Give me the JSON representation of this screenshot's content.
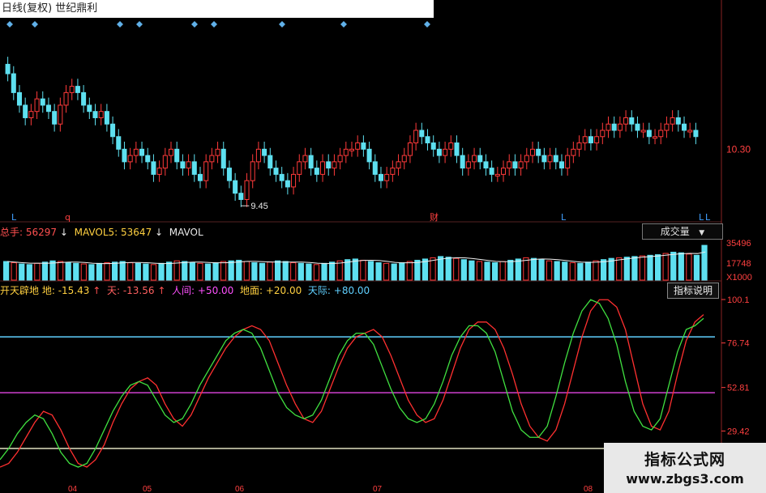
{
  "window": {
    "title": "日线(复权) 世纪鼎利"
  },
  "price_panel": {
    "right_axis_label": "10.30",
    "low_annotation": "9.45",
    "markers": [
      {
        "text": "L",
        "color": "#40a0ff"
      },
      {
        "text": "q",
        "color": "#ff4040"
      },
      {
        "text": "财",
        "color": "#ff4040"
      },
      {
        "text": "L",
        "color": "#40a0ff"
      },
      {
        "text": "L",
        "color": "#40a0ff"
      },
      {
        "text": "L",
        "color": "#40a0ff"
      }
    ]
  },
  "volume_panel": {
    "total_label": "总手:",
    "total_value": "56297",
    "mavol5_label": "MAVOL5:",
    "mavol5_value": "53647",
    "mavol_label": "MAVOL",
    "down_arrow": "↓",
    "dropdown_label": "成交量",
    "dropdown_caret": "▼",
    "axis_labels": [
      "35496",
      "17748",
      "X1000"
    ]
  },
  "indicator_panel": {
    "name": "开天辟地",
    "di_label": "地:",
    "di_value": "-15.43",
    "tian_label": "天:",
    "tian_value": "-13.56",
    "renjian_label": "人间:",
    "renjian_value": "+50.00",
    "dimian_label": "地面:",
    "dimian_value": "+20.00",
    "tianji_label": "天际:",
    "tianji_value": "+80.00",
    "up_arrow": "↑",
    "button_label": "指标说明",
    "axis_labels": [
      "100.1",
      "76.74",
      "52.81",
      "29.42"
    ],
    "x_ticks": [
      "04",
      "05",
      "06",
      "07",
      "08"
    ]
  },
  "watermark": {
    "title": "指标公式网",
    "url": "www.zbgs3.com"
  },
  "chart_data": [
    {
      "type": "candlestick",
      "title": "日线(复权) 世纪鼎利",
      "yticks": [
        "10.30"
      ],
      "annotations": [
        "9.45"
      ],
      "up_color": "#ff3a3a",
      "down_color": "#5ee0f0",
      "close": [
        11.5,
        11.2,
        11.0,
        10.8,
        10.9,
        11.1,
        11.0,
        10.9,
        10.7,
        11.0,
        11.2,
        11.3,
        11.2,
        11.0,
        10.9,
        10.8,
        10.9,
        10.7,
        10.5,
        10.3,
        10.1,
        10.2,
        10.3,
        10.2,
        10.1,
        9.9,
        10.0,
        10.2,
        10.3,
        10.1,
        10.0,
        10.1,
        9.9,
        9.8,
        10.1,
        10.2,
        10.3,
        10.0,
        9.8,
        9.6,
        9.5,
        9.8,
        10.1,
        10.3,
        10.2,
        10.0,
        9.9,
        9.8,
        9.7,
        9.9,
        10.1,
        10.2,
        10.0,
        9.9,
        10.1,
        10.0,
        10.1,
        10.2,
        10.3,
        10.3,
        10.4,
        10.3,
        10.1,
        9.9,
        9.8,
        9.9,
        10.0,
        10.1,
        10.2,
        10.4,
        10.6,
        10.5,
        10.4,
        10.3,
        10.2,
        10.3,
        10.4,
        10.2,
        10.0,
        10.1,
        10.2,
        10.1,
        10.0,
        9.9,
        9.9,
        10.0,
        10.1,
        10.0,
        10.1,
        10.2,
        10.3,
        10.2,
        10.1,
        10.2,
        10.1,
        10.0,
        10.2,
        10.3,
        10.4,
        10.5,
        10.4,
        10.5,
        10.6,
        10.7,
        10.6,
        10.7,
        10.8,
        10.7,
        10.6,
        10.6,
        10.5,
        10.5,
        10.6,
        10.7,
        10.8,
        10.7,
        10.6,
        10.6,
        10.5
      ]
    },
    {
      "type": "bar",
      "title": "成交量",
      "series": [
        {
          "name": "总手",
          "values": [
            30,
            28,
            26,
            25,
            27,
            29,
            31,
            30,
            28,
            27,
            26,
            25,
            27,
            28,
            29,
            30,
            28,
            27,
            26,
            25,
            27,
            29,
            31,
            30,
            28,
            27,
            26,
            28,
            30,
            31,
            32,
            30,
            28,
            27,
            29,
            31,
            30,
            28,
            27,
            26,
            25,
            27,
            29,
            31,
            33,
            34,
            32,
            30,
            28,
            27,
            26,
            28,
            30,
            32,
            34,
            36,
            38,
            37,
            35,
            33,
            31,
            30,
            29,
            28,
            30,
            32,
            34,
            36,
            35,
            33,
            31,
            30,
            29,
            28,
            27,
            29,
            31,
            33,
            35,
            36,
            37,
            38,
            39,
            40,
            41,
            43,
            45,
            44,
            42,
            40,
            56
          ]
        }
      ],
      "yticks": [
        "35496",
        "17748",
        "X1000"
      ]
    },
    {
      "type": "line",
      "title": "开天辟地",
      "yticks": [
        "100.1",
        "76.74",
        "52.81",
        "29.42"
      ],
      "xticks": [
        "04",
        "05",
        "06",
        "07",
        "08"
      ],
      "series": [
        {
          "name": "天",
          "color": "#ff3030",
          "values": [
            10,
            12,
            18,
            26,
            34,
            40,
            38,
            30,
            20,
            12,
            10,
            14,
            22,
            34,
            44,
            52,
            56,
            58,
            54,
            44,
            36,
            32,
            38,
            48,
            58,
            66,
            74,
            80,
            84,
            86,
            84,
            78,
            66,
            54,
            44,
            36,
            34,
            40,
            52,
            64,
            74,
            80,
            82,
            84,
            80,
            70,
            58,
            46,
            38,
            34,
            36,
            46,
            60,
            74,
            84,
            88,
            88,
            84,
            74,
            60,
            44,
            32,
            26,
            24,
            30,
            44,
            62,
            80,
            94,
            100,
            100,
            96,
            84,
            64,
            44,
            32,
            30,
            40,
            60,
            78,
            88,
            92
          ]
        },
        {
          "name": "地",
          "color": "#40e040",
          "values": [
            14,
            20,
            28,
            34,
            38,
            36,
            28,
            18,
            12,
            10,
            12,
            20,
            30,
            40,
            48,
            54,
            56,
            54,
            46,
            38,
            34,
            36,
            44,
            54,
            62,
            70,
            78,
            82,
            84,
            82,
            74,
            62,
            50,
            42,
            38,
            36,
            38,
            46,
            58,
            70,
            78,
            82,
            82,
            76,
            64,
            52,
            42,
            36,
            34,
            36,
            44,
            56,
            70,
            80,
            86,
            86,
            82,
            72,
            56,
            40,
            30,
            26,
            26,
            32,
            48,
            66,
            82,
            94,
            100,
            98,
            90,
            76,
            56,
            40,
            32,
            30,
            36,
            54,
            72,
            84,
            86,
            90
          ]
        }
      ],
      "reference_lines": [
        {
          "label": "天际",
          "value": 80,
          "color": "#60d0ff"
        },
        {
          "label": "人间",
          "value": 50,
          "color": "#d040d0"
        },
        {
          "label": "地面",
          "value": 20,
          "color": "#e0e0c0"
        }
      ]
    }
  ]
}
